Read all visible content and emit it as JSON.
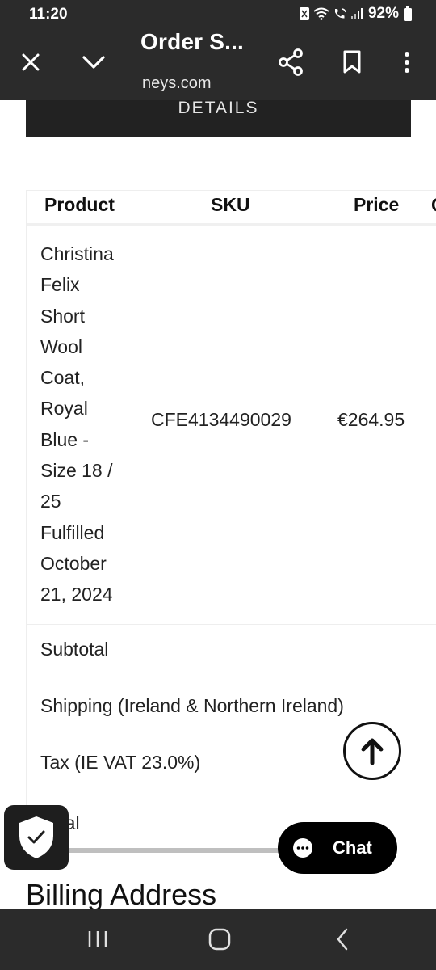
{
  "status_bar": {
    "time": "11:20",
    "battery_percent": "92%",
    "icons": [
      "nfc-icon",
      "wifi-icon",
      "wifi-calling-icon",
      "signal-icon",
      "battery-icon"
    ]
  },
  "toolbar": {
    "title": "Order S...",
    "url": "neys.com",
    "icons": [
      "close-icon",
      "chevron-down-icon",
      "share-icon",
      "bookmark-icon",
      "more-vert-icon"
    ]
  },
  "page": {
    "details_button_label": "DETAILS",
    "table": {
      "headers": [
        "Product",
        "SKU",
        "Price",
        "Q"
      ],
      "rows": [
        {
          "product_lines": [
            "Christina",
            "Felix",
            "Short",
            "Wool",
            "Coat,",
            "Royal",
            "Blue -",
            "Size 18 /",
            "25",
            "Fulfilled",
            "October",
            "21, 2024"
          ],
          "sku": "CFE4134490029",
          "price": "€264.95"
        }
      ],
      "summary": {
        "subtotal": "Subtotal",
        "shipping": "Shipping (Ireland & Northern Ireland)",
        "tax": "Tax (IE VAT 23.0%)",
        "total": "Total"
      }
    },
    "billing_heading": "Billing Address"
  },
  "floating": {
    "chat_label": "Chat",
    "icons": [
      "arrow-up-icon",
      "shield-check-icon",
      "chat-bubble-icon"
    ]
  },
  "navbar": {
    "icons": [
      "recent-apps-icon",
      "home-icon",
      "back-icon"
    ]
  },
  "colors": {
    "system_bar": "#2b2b2b",
    "details_button": "#222222",
    "chat_button": "#000000",
    "page_background": "#ffffff"
  }
}
